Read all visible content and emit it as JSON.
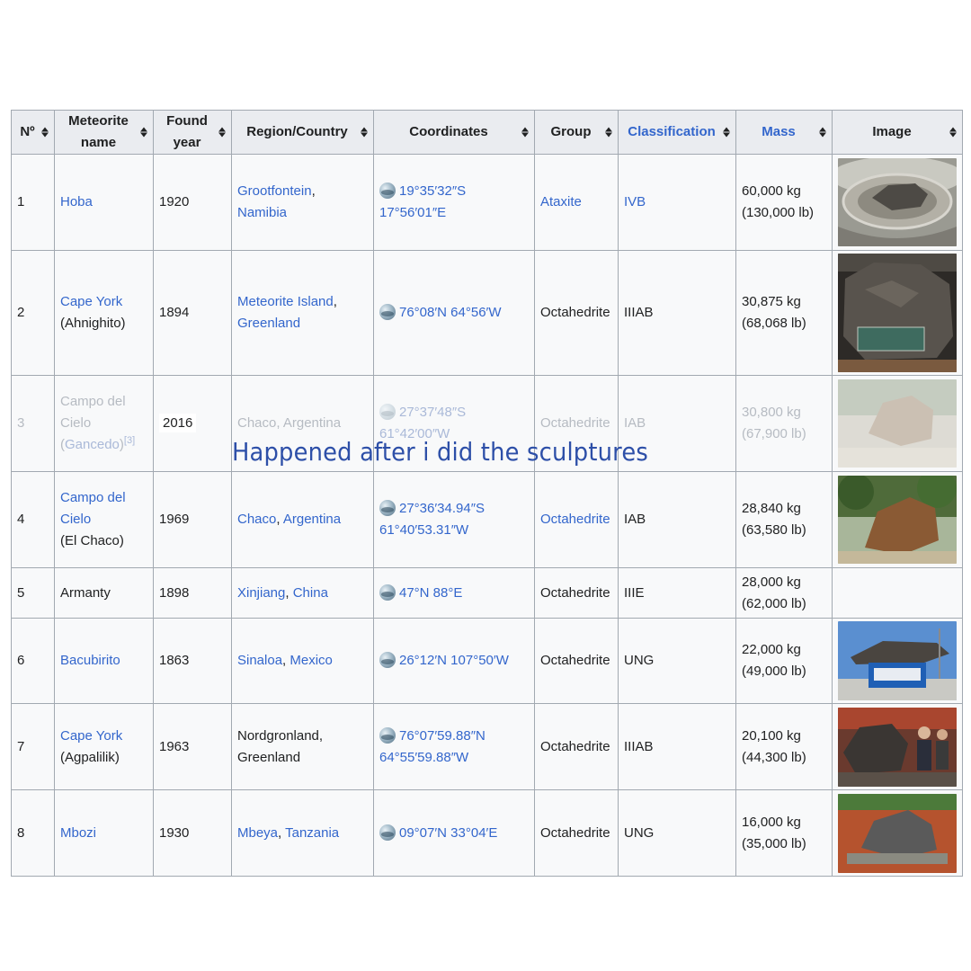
{
  "headers": {
    "no": "Nº",
    "name": "Meteorite name",
    "year": "Found year",
    "region": "Region/Country",
    "coords": "Coordinates",
    "group": "Group",
    "classification": "Classification",
    "mass": "Mass",
    "image": "Image"
  },
  "rows": [
    {
      "no": "1",
      "name": "Hoba",
      "name_extra": "",
      "year": "1920",
      "region_a": "Grootfontein",
      "region_sep": ",",
      "region_b": "Namibia",
      "coord_1": "19°35′32″S",
      "coord_2": "17°56′01″E",
      "group": "Ataxite",
      "classification": "IVB",
      "mass_kg": "60,000 kg",
      "mass_lb": "(130,000 lb)"
    },
    {
      "no": "2",
      "name": "Cape York",
      "name_extra": "(Ahnighito)",
      "year": "1894",
      "region_a": "Meteorite Island",
      "region_sep": ",",
      "region_b": "Greenland",
      "coord_1": "76°08′N 64°56′W",
      "coord_2": "",
      "group": "Octahedrite",
      "classification": "IIIAB",
      "mass_kg": "30,875 kg",
      "mass_lb": "(68,068 lb)"
    },
    {
      "no": "3",
      "name": "Campo del Cielo",
      "name_extra": "Gancedo",
      "name_ref": "[3]",
      "year": "2016",
      "region_a": "Chaco, Argentina",
      "region_sep": "",
      "region_b": "",
      "coord_1": "27°37′48″S",
      "coord_2": "61°42′00″W",
      "group": "Octahedrite",
      "classification": "IAB",
      "mass_kg": "30,800 kg",
      "mass_lb": "(67,900 lb)"
    },
    {
      "no": "4",
      "name": "Campo del Cielo",
      "name_extra": "(El Chaco)",
      "year": "1969",
      "region_a": "Chaco",
      "region_sep": ",",
      "region_b": "Argentina",
      "coord_1": "27°36′34.94″S",
      "coord_2": "61°40′53.31″W",
      "group": "Octahedrite",
      "classification": "IAB",
      "mass_kg": "28,840 kg",
      "mass_lb": "(63,580 lb)"
    },
    {
      "no": "5",
      "name": "Armanty",
      "name_extra": "",
      "year": "1898",
      "region_a": "Xinjiang",
      "region_sep": ",",
      "region_b": "China",
      "coord_1": "47°N 88°E",
      "coord_2": "",
      "group": "Octahedrite",
      "classification": "IIIE",
      "mass_kg": "28,000 kg",
      "mass_lb": "(62,000 lb)"
    },
    {
      "no": "6",
      "name": "Bacubirito",
      "name_extra": "",
      "year": "1863",
      "region_a": "Sinaloa",
      "region_sep": ",",
      "region_b": "Mexico",
      "coord_1": "26°12′N 107°50′W",
      "coord_2": "",
      "group": "Octahedrite",
      "classification": "UNG",
      "mass_kg": "22,000 kg",
      "mass_lb": "(49,000 lb)"
    },
    {
      "no": "7",
      "name": "Cape York",
      "name_extra": "(Agpalilik)",
      "year": "1963",
      "region_a": "Nordgronland,",
      "region_sep": "",
      "region_b": "Greenland",
      "coord_1": "76°07′59.88″N",
      "coord_2": "64°55′59.88″W",
      "group": "Octahedrite",
      "classification": "IIIAB",
      "mass_kg": "20,100 kg",
      "mass_lb": "(44,300 lb)"
    },
    {
      "no": "8",
      "name": "Mbozi",
      "name_extra": "",
      "year": "1930",
      "region_a": "Mbeya",
      "region_sep": ",",
      "region_b": "Tanzania",
      "coord_1": "09°07′N 33°04′E",
      "coord_2": "",
      "group": "Octahedrite",
      "classification": "UNG",
      "mass_kg": "16,000 kg",
      "mass_lb": "(35,000 lb)"
    }
  ],
  "overlay_caption": "Happened after i did the sculptures",
  "colors": {
    "link": "#3366cc",
    "header_bg": "#eaecf0",
    "cell_bg": "#f8f9fa",
    "border": "#a2a9b1",
    "caption": "#2d4fa8"
  }
}
